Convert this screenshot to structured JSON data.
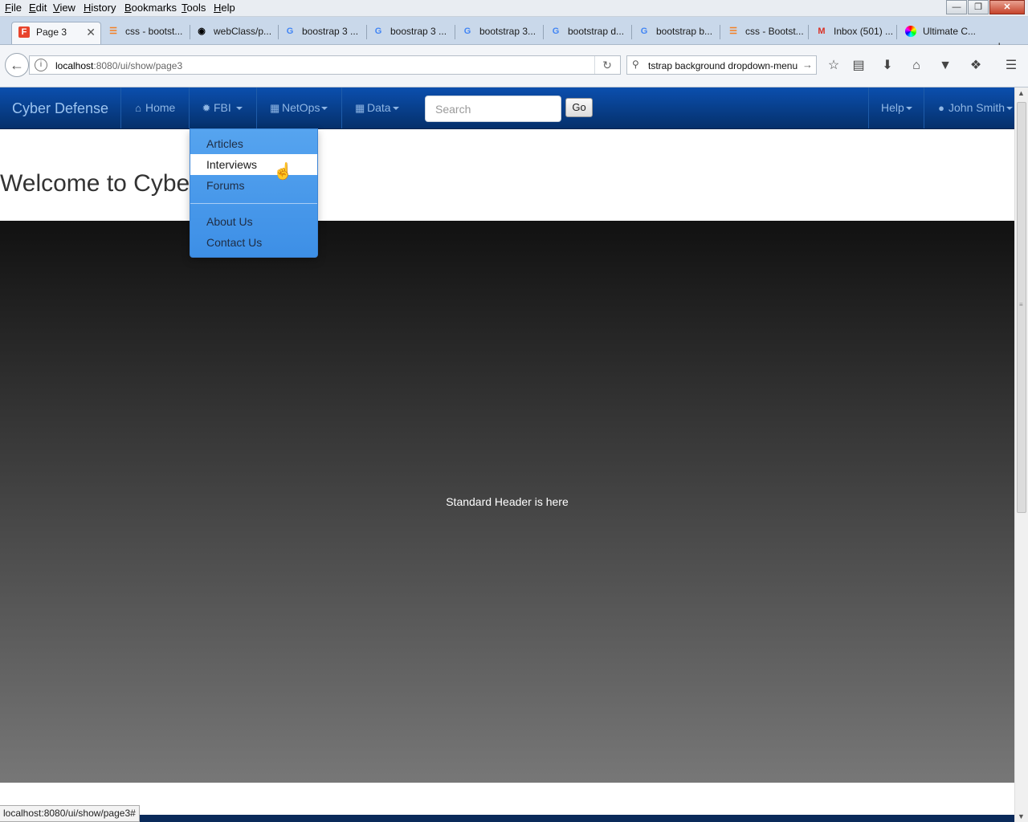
{
  "menubar": {
    "items": [
      "File",
      "Edit",
      "View",
      "History",
      "Bookmarks",
      "Tools",
      "Help"
    ]
  },
  "tabs": [
    {
      "title": "Page 3",
      "icon": "page-favicon",
      "active": true
    },
    {
      "title": "css - bootst...",
      "icon": "stackoverflow-icon"
    },
    {
      "title": "webClass/p...",
      "icon": "github-icon"
    },
    {
      "title": "boostrap 3 ...",
      "icon": "google-icon"
    },
    {
      "title": "boostrap 3 ...",
      "icon": "google-icon"
    },
    {
      "title": "bootstrap 3...",
      "icon": "google-icon"
    },
    {
      "title": "bootstrap d...",
      "icon": "google-icon"
    },
    {
      "title": "bootstrap b...",
      "icon": "google-icon"
    },
    {
      "title": "css - Bootst...",
      "icon": "stackoverflow-icon"
    },
    {
      "title": "Inbox (501) ...",
      "icon": "gmail-icon"
    },
    {
      "title": "Ultimate C...",
      "icon": "colorwheel-icon"
    }
  ],
  "address": {
    "host": "localhost",
    "rest": ":8080/ui/show/page3"
  },
  "search": {
    "text": "tstrap background dropdown-menu"
  },
  "site": {
    "brand": "Cyber Defense",
    "nav": {
      "home": "Home",
      "fbi": "FBI",
      "netops": "NetOps",
      "data": "Data",
      "help": "Help",
      "user": "John Smith"
    },
    "search_placeholder": "Search",
    "go": "Go",
    "dropdown": {
      "items": [
        "Articles",
        "Interviews",
        "Forums",
        "About Us",
        "Contact Us"
      ],
      "active": "Interviews"
    },
    "welcome": "Welcome to Cybe",
    "hero_text": "Standard Header is here"
  },
  "status": "localhost:8080/ui/show/page3#",
  "colors": {
    "navbar_top": "#0b4fae",
    "navbar_bottom": "#05306b",
    "dropdown_bg": "#4a9aeb"
  }
}
